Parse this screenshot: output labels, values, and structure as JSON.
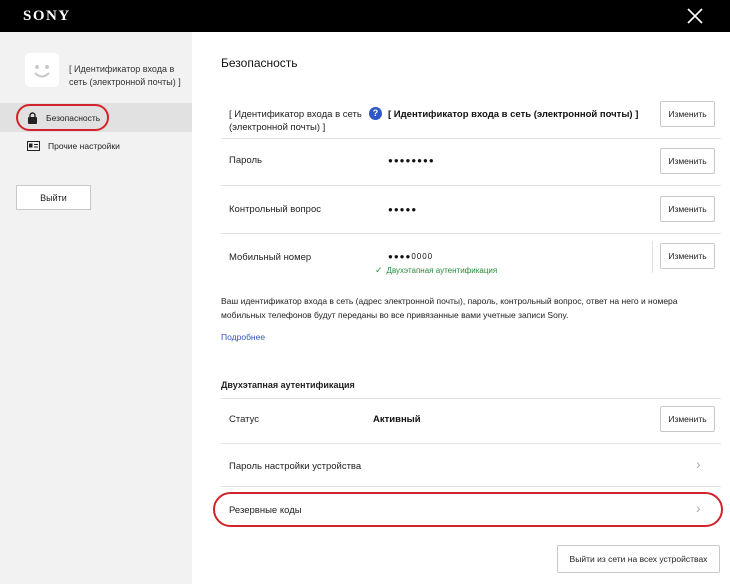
{
  "app": {
    "logo": "SONY"
  },
  "sidebar": {
    "account_name": "[ Идентификатор входа в сеть (электронной почты) ]",
    "items": [
      {
        "label": "Безопасность"
      },
      {
        "label": "Прочие настройки"
      }
    ],
    "logout_label": "Выйти"
  },
  "main": {
    "title": "Безопасность",
    "rows": [
      {
        "label": "[ Идентификатор входа в сеть (электронной почты) ]",
        "value": "[ Идентификатор входа в сеть (электронной почты) ]",
        "button": "Изменить"
      },
      {
        "label": "Пароль",
        "value": "●●●●●●●●",
        "button": "Изменить"
      },
      {
        "label": "Контрольный вопрос",
        "value": "●●●●●",
        "button": "Изменить"
      },
      {
        "label": "Мобильный номер",
        "value": "●●●●0000",
        "note": "Двухэтапная аутентификация",
        "button": "Изменить"
      }
    ],
    "info_text": "Ваш идентификатор входа в сеть (адрес электронной почты), пароль, контрольный вопрос, ответ на него и номера мобильных телефонов будут переданы во все привязанные вами учетные записи Sony.",
    "more_link": "Подробнее",
    "two_step": {
      "title": "Двухэтапная аутентификация",
      "status_label": "Статус",
      "status_value": "Активный",
      "status_button": "Изменить",
      "device_password_label": "Пароль настройки устройства",
      "backup_codes_label": "Резервные коды"
    },
    "logout_all_label": "Выйти из сети на всех устройствах"
  },
  "colors": {
    "highlight_ring": "#d2232a",
    "link": "#2f57c5",
    "success": "#2a8b3c"
  },
  "icons": [
    "close-icon",
    "lock-icon",
    "id-card-icon",
    "help-icon",
    "check-icon",
    "chevron-right-icon"
  ]
}
